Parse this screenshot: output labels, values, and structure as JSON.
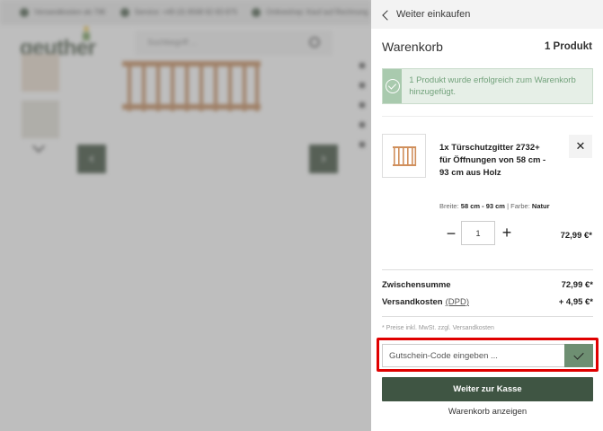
{
  "background_shop": {
    "topbar_items": [
      "Versandkosten ab 79€",
      "Service: +49 (0) 9568 92 83 875",
      "Onlineshop: Kauf auf Rechnung"
    ],
    "logo_text": "geuther",
    "search_placeholder": "Suchbegriff ...",
    "nav_prev": "‹",
    "nav_next": "›"
  },
  "cart": {
    "back_link": "Weiter einkaufen",
    "title": "Warenkorb",
    "count_label": "1 Produkt",
    "success_message": "1 Produkt wurde erfolgreich zum Warenkorb hinzugefügt.",
    "item": {
      "name": "1x Türschutzgitter 2732+ für Öffnungen von 58 cm - 93 cm aus Holz",
      "variant_width_label": "Breite:",
      "variant_width_value": "58 cm - 93 cm",
      "variant_sep": "|",
      "variant_color_label": "Farbe:",
      "variant_color_value": "Natur",
      "quantity": "1",
      "minus_symbol": "−",
      "plus_symbol": "+",
      "remove_symbol": "✕",
      "price": "72,99 €*"
    },
    "subtotal_label": "Zwischensumme",
    "subtotal_value": "72,99 €*",
    "shipping_label": "Versandkosten",
    "shipping_carrier": "(DPD)",
    "shipping_value": "+ 4,95 €*",
    "tax_note": "* Preise inkl. MwSt. zzgl. Versandkosten",
    "coupon_placeholder": "Gutschein-Code eingeben ...",
    "checkout_button": "Weiter zur Kasse",
    "view_cart_link": "Warenkorb anzeigen"
  },
  "colors": {
    "primary_green": "#3f5543",
    "success_bg": "#e6efe7",
    "success_text": "#73a27c",
    "coupon_button": "#6e8f72",
    "highlight_red": "#e00000"
  }
}
